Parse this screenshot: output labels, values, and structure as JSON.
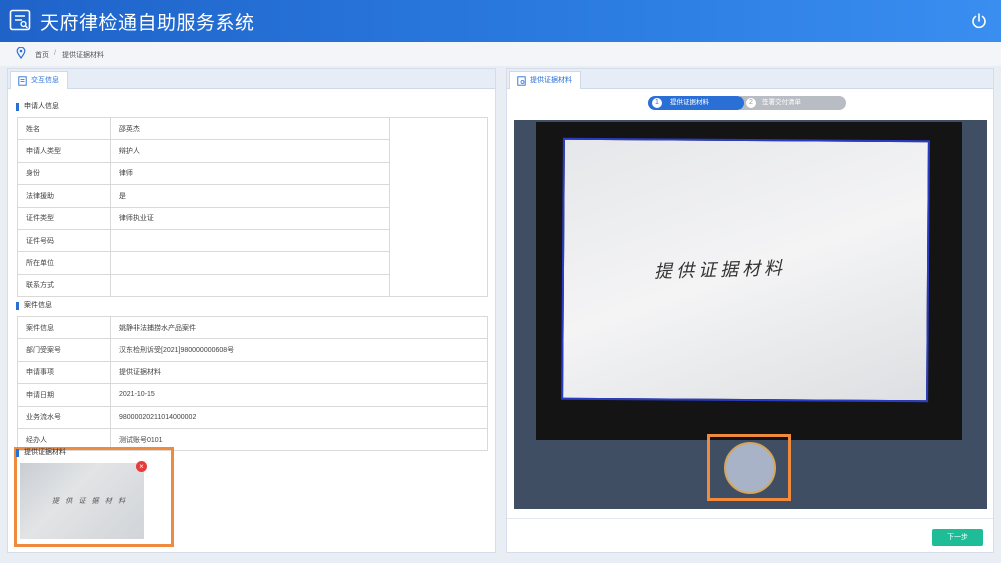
{
  "header": {
    "title": "天府律检通自助服务系统",
    "logo_icon": "document-list-icon",
    "power_icon": "power-icon"
  },
  "breadcrumb": {
    "home": "首页",
    "separator": "/",
    "current": "提供证据材料"
  },
  "left_panel": {
    "tab_label": "交互信息",
    "applicant_section": "申请人信息",
    "applicant_rows": [
      {
        "label": "姓名",
        "value": "邵英杰"
      },
      {
        "label": "申请人类型",
        "value": "辩护人"
      },
      {
        "label": "身份",
        "value": "律师"
      },
      {
        "label": "法律援助",
        "value": "是"
      },
      {
        "label": "证件类型",
        "value": "律师执业证"
      },
      {
        "label": "证件号码",
        "value": ""
      },
      {
        "label": "所在单位",
        "value": ""
      },
      {
        "label": "联系方式",
        "value": ""
      }
    ],
    "case_section": "案件信息",
    "case_rows": [
      {
        "label": "案件信息",
        "value": "姚静非法捕捞水产品案件"
      },
      {
        "label": "部门受案号",
        "value": "汉东检刑诉受[2021]980000000608号"
      },
      {
        "label": "申请事项",
        "value": "提供证据材料"
      },
      {
        "label": "申请日期",
        "value": "2021-10-15"
      },
      {
        "label": "业务流水号",
        "value": "98000020211014000002"
      },
      {
        "label": "经办人",
        "value": "测试账号0101"
      }
    ],
    "evidence_section": "提供证据材料",
    "thumbnail_text": "提 供 证 据 材 料",
    "thumbnail_close": "×"
  },
  "right_panel": {
    "tab_label": "提供证据材料",
    "steps": [
      {
        "num": "1",
        "label": "提供证据材料",
        "active": true
      },
      {
        "num": "2",
        "label": "签署交付清单",
        "active": false
      }
    ],
    "camera_text": "提供证据材料",
    "next_button": "下一步"
  },
  "colors": {
    "accent": "#2a6fd6",
    "highlight": "#f08a3c",
    "next": "#1ebd97",
    "camera_bg": "#3f4e63"
  }
}
